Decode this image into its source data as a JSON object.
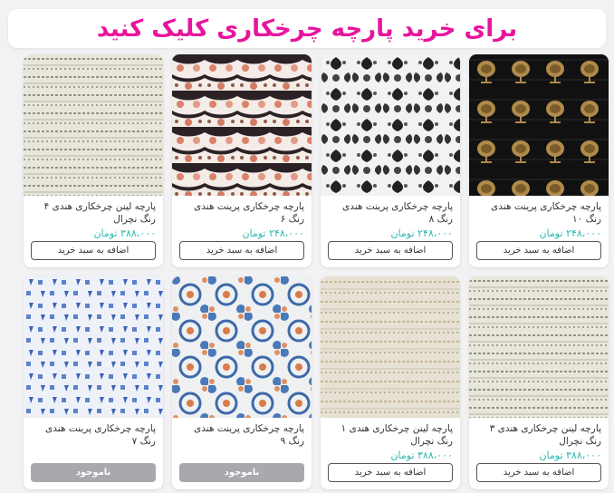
{
  "banner": {
    "text": "برای خرید پارچه چرخکاری کلیک کنید",
    "color": "#e8149d"
  },
  "colors": {
    "price": "#2fb8b0",
    "out_of_stock_button": "#a7a9ac"
  },
  "products": [
    {
      "title": "پارچه چرخکاری پرینت هندی رنگ ۱۰",
      "price": "۲۴۸،۰۰۰ تومان",
      "button": "اضافه به سبد خرید",
      "in_stock": true
    },
    {
      "title": "پارچه چرخکاری پرینت هندی رنگ ۸",
      "price": "۲۴۸،۰۰۰ تومان",
      "button": "اضافه به سبد خرید",
      "in_stock": true
    },
    {
      "title": "پارچه چرخکاری پرینت هندی رنگ ۶",
      "price": "۲۴۸،۰۰۰ تومان",
      "button": "اضافه به سبد خرید",
      "in_stock": true
    },
    {
      "title": "پارچه لینن چرخکاری هندی ۴ رنگ نچرال",
      "price": "۳۸۸،۰۰۰ تومان",
      "button": "اضافه به سبد خرید",
      "in_stock": true
    },
    {
      "title": "پارچه لینن چرخکاری هندی ۳ رنگ نچرال",
      "price": "۳۸۸،۰۰۰ تومان",
      "button": "اضافه به سبد خرید",
      "in_stock": true
    },
    {
      "title": "پارچه لینن چرخکاری هندی ۱ رنگ نچرال",
      "price": "۳۸۸،۰۰۰ تومان",
      "button": "اضافه به سبد خرید",
      "in_stock": true
    },
    {
      "title": "پارچه چرخکاری پرینت هندی رنگ ۹",
      "price": "",
      "button": "ناموجود",
      "in_stock": false
    },
    {
      "title": "پارچه چرخکاری پرینت هندی رنگ ۷",
      "price": "",
      "button": "ناموجود",
      "in_stock": false
    }
  ]
}
